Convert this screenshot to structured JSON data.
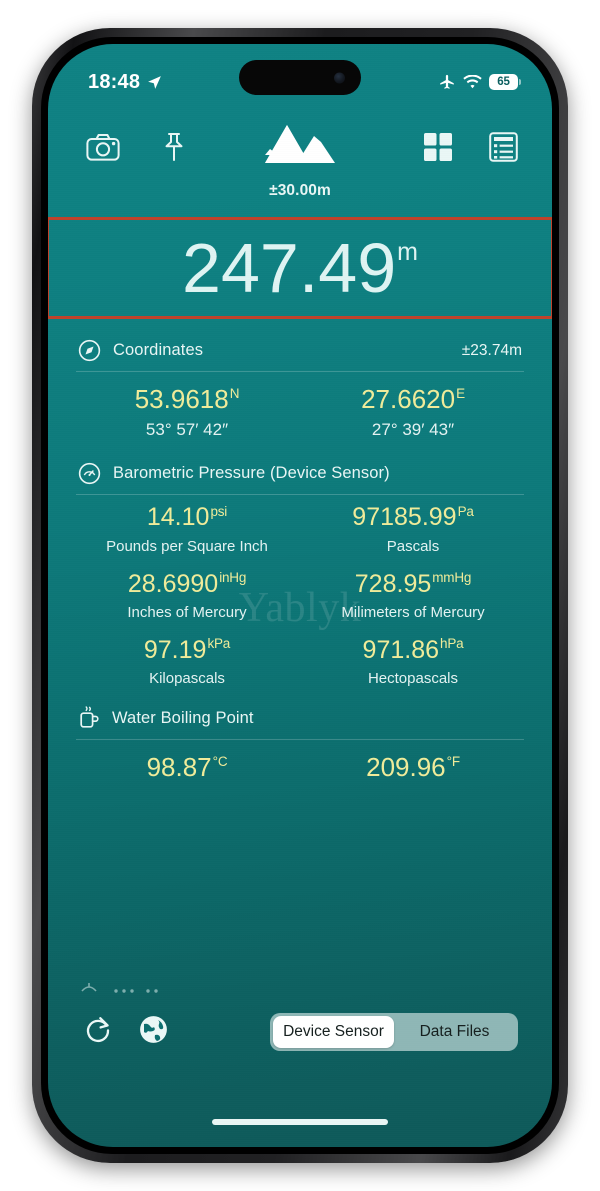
{
  "status_bar": {
    "time": "18:48",
    "location_icon": "location-arrow-icon",
    "airplane_icon": "airplane-mode-icon",
    "wifi_icon": "wifi-icon",
    "battery_percent": "65"
  },
  "app_bar": {
    "camera_icon": "camera-icon",
    "pin_icon": "pin-icon",
    "logo_icon": "mountain-logo-icon",
    "grid_icon": "grid-view-icon",
    "list_icon": "list-view-icon"
  },
  "logo": {
    "accuracy": "±30.00m"
  },
  "altitude": {
    "value": "247.49",
    "unit": "m",
    "highlight_color": "#c0422a"
  },
  "sections": [
    {
      "id": "coordinates",
      "icon": "compass-icon",
      "title": "Coordinates",
      "accuracy": "±23.74m",
      "cells": [
        {
          "value": "53.9618",
          "unit": "N",
          "sub": "53° 57′ 42″"
        },
        {
          "value": "27.6620",
          "unit": "E",
          "sub": "27° 39′ 43″"
        }
      ]
    },
    {
      "id": "barometric-pressure",
      "icon": "gauge-icon",
      "title": "Barometric Pressure (Device Sensor)",
      "accuracy": "",
      "cells": [
        {
          "value": "14.10",
          "unit": "psi",
          "sub": "Pounds per Square Inch"
        },
        {
          "value": "97185.99",
          "unit": "Pa",
          "sub": "Pascals"
        },
        {
          "value": "28.6990",
          "unit": "inHg",
          "sub": "Inches of Mercury"
        },
        {
          "value": "728.95",
          "unit": "mmHg",
          "sub": "Milimeters of Mercury"
        },
        {
          "value": "97.19",
          "unit": "kPa",
          "sub": "Kilopascals"
        },
        {
          "value": "971.86",
          "unit": "hPa",
          "sub": "Hectopascals"
        }
      ]
    },
    {
      "id": "water-boiling-point",
      "icon": "cup-icon",
      "title": "Water Boiling Point",
      "accuracy": "",
      "cells": [
        {
          "value": "98.87",
          "unit": "°C",
          "sub": ""
        },
        {
          "value": "209.96",
          "unit": "°F",
          "sub": ""
        }
      ]
    }
  ],
  "watermark": "Yablyk",
  "bottom_bar": {
    "refresh_icon": "refresh-icon",
    "globe_icon": "globe-icon",
    "segments": [
      {
        "label": "Device Sensor",
        "active": true
      },
      {
        "label": "Data Files",
        "active": false
      }
    ]
  },
  "colors": {
    "screen_teal": "#0e8081",
    "screen_teal_dark": "#0d6060",
    "value_yellow": "#f0ec9a",
    "text_light": "#e9f6f5",
    "highlight_red": "#c0422a"
  }
}
